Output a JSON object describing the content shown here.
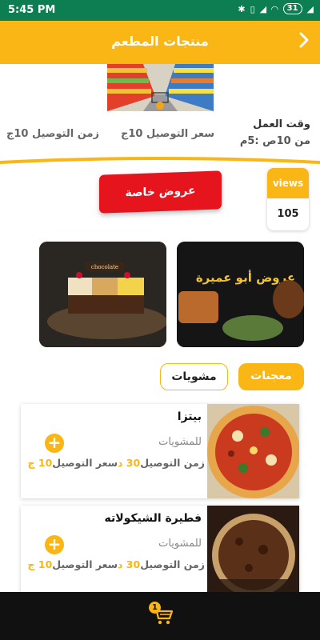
{
  "status_bar": {
    "time": "5:45 PM",
    "battery": "31"
  },
  "header": {
    "title": "منتجات المطعم",
    "back_icon": "chevron-right-icon"
  },
  "restaurant_info": {
    "working_time_label": "وقت العمل",
    "working_time_value": "من 10ص :5م",
    "delivery_price": "سعر التوصيل 10ج",
    "delivery_time": "زمن التوصيل 10ج"
  },
  "offers_button": {
    "label": "عروض خاصة"
  },
  "views": {
    "label": "views",
    "count": "105"
  },
  "promos": [
    {
      "title": "عروض أبو عميرة"
    },
    {
      "title": "chocolate"
    }
  ],
  "category_tabs": [
    {
      "label": "معجنات",
      "active": true
    },
    {
      "label": "مشويات",
      "active": false
    }
  ],
  "products": [
    {
      "name": "بيتزا",
      "category": "للمشويات",
      "delivery_time_label": "زمن التوصيل",
      "delivery_time_value": "30",
      "delivery_time_unit": "د",
      "delivery_price_label": "سعر التوصيل",
      "delivery_price_value": "10",
      "delivery_price_unit": "ج"
    },
    {
      "name": "فطيرة الشيكولاته",
      "category": "للمشويات",
      "delivery_time_label": "زمن التوصيل",
      "delivery_time_value": "30",
      "delivery_time_unit": "د",
      "delivery_price_label": "سعر التوصيل",
      "delivery_price_value": "10",
      "delivery_price_unit": "ج"
    }
  ],
  "cart": {
    "count": "1"
  },
  "colors": {
    "accent": "#f9b614",
    "status_bar": "#0d7d52",
    "offer_red": "#e6141c",
    "bottom_bar": "#111111"
  }
}
